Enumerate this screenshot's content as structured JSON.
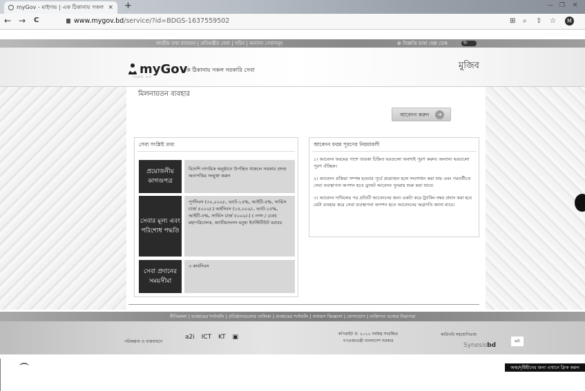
{
  "browser": {
    "tab_title": "myGov - মাইগভ | এক ঠিকানায় সকল ...",
    "tab_close": "×",
    "new_tab": "+",
    "url_host": "www.mygov.bd",
    "url_path": "/service/?id=BDGS-1637559502",
    "profile_initial": "M",
    "back": "←",
    "forward": "→",
    "reload": "C",
    "win_minimize": "—",
    "win_restore": "❐",
    "win_close": "✕"
  },
  "topbar": {
    "links": "জাতীয় তথ্য বাতায়ন  |  প্রতিমন্ত্রীর সেবা  |  সচিব  |  অন্যান্য সেবাসমূহ",
    "right_links": "⊕  বিজ্ঞপ্তি  ভাষা  হেল্প ডেস্ক",
    "toggle": "ইং"
  },
  "header": {
    "logo": "myGov",
    "tagline": "এক ঠিকানায় সকল সরকারি সেবা",
    "logo_sub": "সরকারি সেবা",
    "nation_logo": "মুজিব"
  },
  "page": {
    "title": "মিলনায়তন ব্যবহার",
    "apply_button": "আবেদন করুন",
    "apply_icon": "arrow-right-icon"
  },
  "service_panel": {
    "heading": "সেবা সংশ্লিষ্ট তথ্য",
    "rows": [
      {
        "label": "প্রয়োজনীয় কাগজপত্র",
        "value": "বিদেশি নাগরিক অনুষ্ঠানে উপস্থিত থাকলে সরকার প্রদত্ত অনাপত্তির সংযুক্ত করুন"
      },
      {
        "label": "সেবার মূল্য এবং পরিশোধ পদ্ধতি",
        "value": "পূর্ণদিবস (৩০,০০০/-, ভ্যাট-১৫%, আইটি-৫%, সার্ভিস চার্জ ৫০০০/-) অর্ধদিবস (১৫,০০০/-, ভ্যাট-১৫%, আইটি-৫%, সার্ভিস চার্জ ৫০০০/-) ( নগদ / চেক) মহাপরিচালক, জাতীয়সংসদ মনুষ্য ইনস্টিটিউট বরাবর"
      },
      {
        "label": "সেবা প্রদানের সময়সীমা",
        "value": "৩ কার্যদিবস"
      }
    ]
  },
  "rules_panel": {
    "heading": "আবেদন ফরম পূরণের নিয়মাবলী",
    "rules": [
      "১। আবেদন ফরমের পাশে তারকা চিহ্নিত ঘরগুলো অবশ্যই পূরণ করুন। অন্যান্য ঘরগুলো পূরণ ঐচ্ছিক।",
      "২। আবেদন প্রক্রিয়া সম্পন্ন হওয়ার পূর্বে প্রয়োজন হলে সংশোধন করা যায় এবং পরবর্তীতে সেবা ব্যবস্থাপনা অপশন হতে ড্রাফট আবেদন পুনরায় শুরু করা যাবে।",
      "৩। আবেদন দাখিলের পর প্রতিটি আবেদনের জন্য একটা করে ট্র্যাকিং নম্বর প্রদান করা হবে যেটা ব্যবহার করে সেবা ব্যবস্থাপনা অপশন হতে আবেদনের অগ্রগতি জানা যাবে।"
    ]
  },
  "footer": {
    "nav_links": "নীতিমালা  |  ব্যবহারের শর্তাবলি  |  প্রতিষ্ঠানগুলোর তালিকা  |  ব্যবহারের শর্তাবলি  |  সাধারণ জিজ্ঞাসা  |  যোগাযোগ  |  ব্যক্তিগত তথ্যের নিরাপত্তা",
    "plan": "পরিকল্পনা ও বাস্তবায়নে",
    "logos": [
      "a2i",
      "ICT",
      "KT",
      "▣"
    ],
    "copyright": "কপিরাইট © ২০২২ সর্বস্বত্ব সংরক্ষিত",
    "copyright_sub": "গণপ্রজাতন্ত্রী বাংলাদেশ সরকার",
    "tech_label": "কারিগরি সহযোগিতায়",
    "tech_logo": "bd",
    "tech_logo_prefix": "Synesis",
    "chat_label": "a2i",
    "accessibility": "অন্ধ/দৃষ্টিহীনের জন্য এখানে ক্লিক করুন"
  }
}
